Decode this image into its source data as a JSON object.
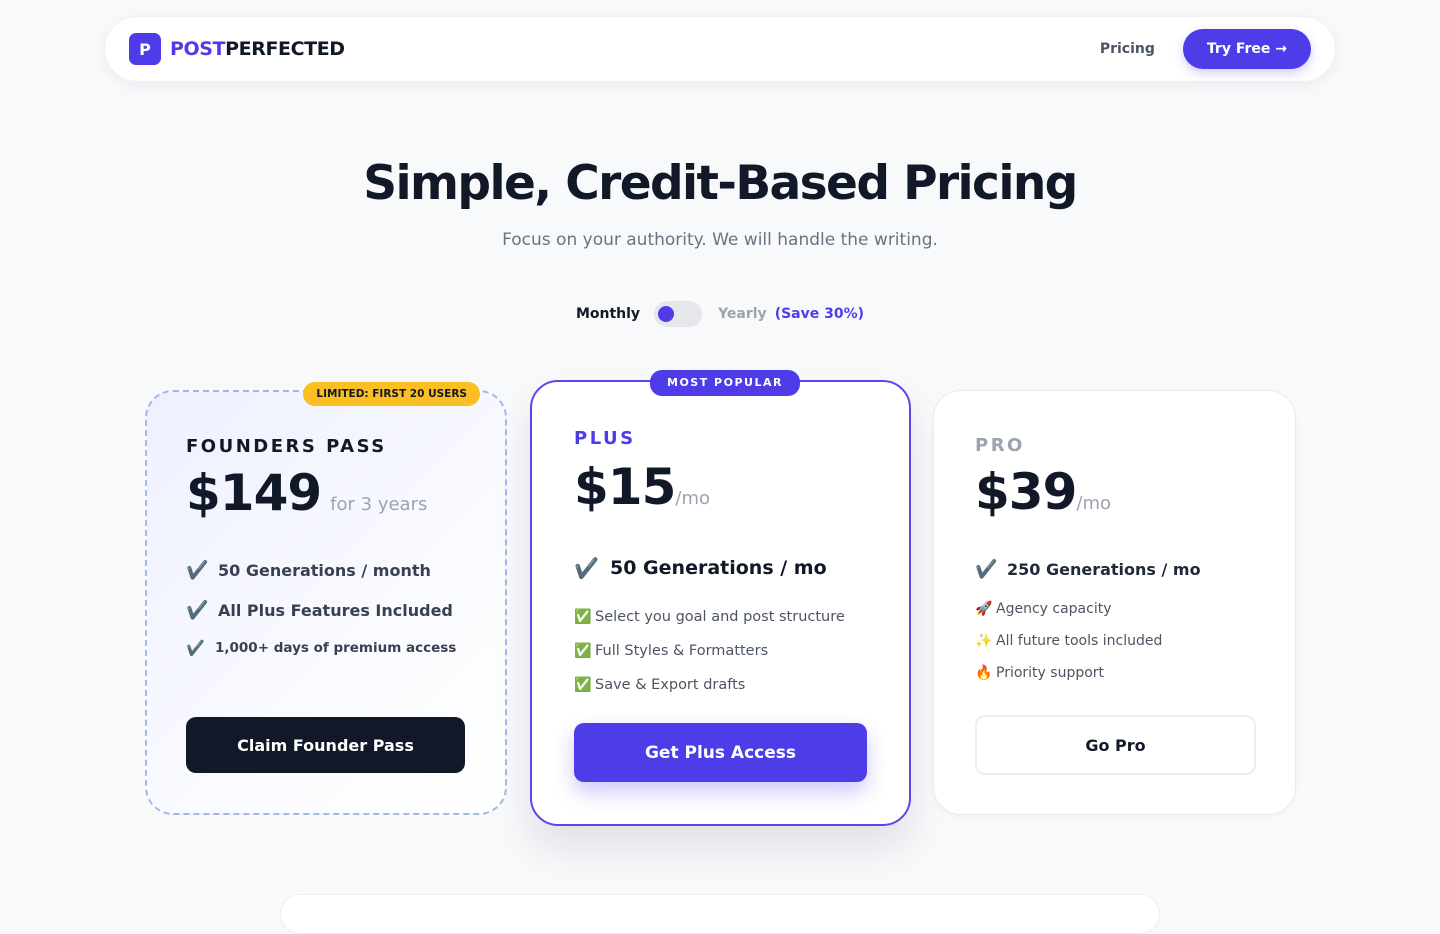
{
  "nav": {
    "logo_letter": "P",
    "brand_part1": "POST",
    "brand_part2": "PERFECTED",
    "link_pricing": "Pricing",
    "cta_label": "Try Free →"
  },
  "hero": {
    "title": "Simple, Credit-Based Pricing",
    "subtitle": "Focus on your authority. We will handle the writing."
  },
  "billing": {
    "monthly_label": "Monthly",
    "yearly_label": "Yearly",
    "save_label": "(Save 30%)",
    "selected": "Monthly"
  },
  "plans": {
    "founders": {
      "badge": "LIMITED: FIRST 20 USERS",
      "name": "FOUNDERS PASS",
      "price": "$149",
      "price_suffix": "for 3 years",
      "features": [
        {
          "check": "✔️",
          "text": "50 Generations / month"
        },
        {
          "check": "✔️",
          "text": "All Plus Features Included"
        },
        {
          "check": "✔️",
          "text": "1,000+ days of premium access"
        }
      ],
      "cta": "Claim Founder Pass"
    },
    "plus": {
      "badge": "MOST POPULAR",
      "name": "PLUS",
      "price": "$15",
      "price_suffix": "/mo",
      "headline_check": "✔️",
      "headline": "50 Generations / mo",
      "features": [
        {
          "icon": "✅",
          "text": "Select you goal and post structure"
        },
        {
          "icon": "✅",
          "text": "Full Styles & Formatters"
        },
        {
          "icon": "✅",
          "text": "Save & Export drafts"
        }
      ],
      "cta": "Get Plus Access"
    },
    "pro": {
      "name": "PRO",
      "price": "$39",
      "price_suffix": "/mo",
      "headline_check": "✔️",
      "headline": "250 Generations / mo",
      "features": [
        {
          "icon": "🚀",
          "text": "Agency capacity"
        },
        {
          "icon": "✨",
          "text": "All future tools included"
        },
        {
          "icon": "🔥",
          "text": "Priority support"
        }
      ],
      "cta": "Go Pro"
    }
  },
  "colors": {
    "brand": "#4f3ce9",
    "dark": "#111827",
    "badge_limited": "#fbbf24",
    "background": "#f8f9fb"
  }
}
